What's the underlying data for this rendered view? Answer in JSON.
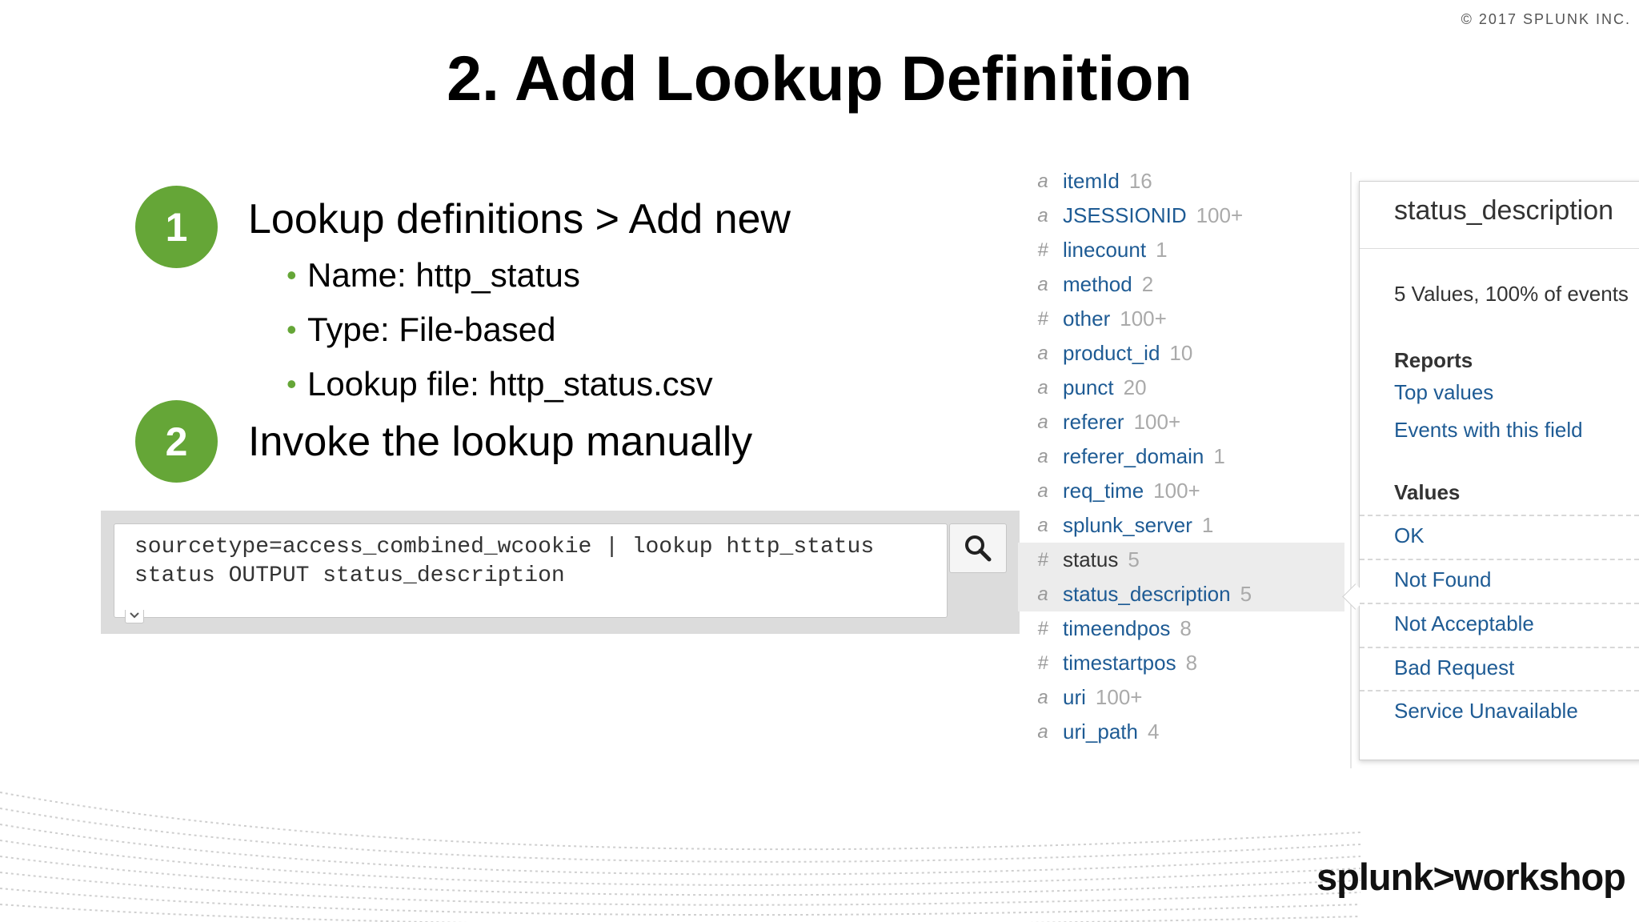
{
  "copyright": "© 2017 SPLUNK INC.",
  "slide_title": "2. Add Lookup Definition",
  "steps": [
    {
      "number": "1",
      "heading": "Lookup definitions > Add new",
      "bullets": [
        "Name: http_status",
        "Type: File-based",
        "Lookup file: http_status.csv"
      ]
    },
    {
      "number": "2",
      "heading": "Invoke the lookup manually"
    }
  ],
  "search": {
    "query_line1": "sourcetype=access_combined_wcookie | lookup http_status",
    "query_line2": "status OUTPUT status_description",
    "button_icon": "search-icon"
  },
  "fields": [
    {
      "type": "a",
      "name": "itemId",
      "count": "16"
    },
    {
      "type": "a",
      "name": "JSESSIONID",
      "count": "100+"
    },
    {
      "type": "#",
      "name": "linecount",
      "count": "1"
    },
    {
      "type": "a",
      "name": "method",
      "count": "2"
    },
    {
      "type": "#",
      "name": "other",
      "count": "100+"
    },
    {
      "type": "a",
      "name": "product_id",
      "count": "10"
    },
    {
      "type": "a",
      "name": "punct",
      "count": "20"
    },
    {
      "type": "a",
      "name": "referer",
      "count": "100+"
    },
    {
      "type": "a",
      "name": "referer_domain",
      "count": "1"
    },
    {
      "type": "a",
      "name": "req_time",
      "count": "100+"
    },
    {
      "type": "a",
      "name": "splunk_server",
      "count": "1"
    },
    {
      "type": "#",
      "name": "status",
      "count": "5"
    },
    {
      "type": "a",
      "name": "status_description",
      "count": "5"
    },
    {
      "type": "#",
      "name": "timeendpos",
      "count": "8"
    },
    {
      "type": "#",
      "name": "timestartpos",
      "count": "8"
    },
    {
      "type": "a",
      "name": "uri",
      "count": "100+"
    },
    {
      "type": "a",
      "name": "uri_path",
      "count": "4"
    }
  ],
  "popup": {
    "title": "status_description",
    "summary": "5 Values, 100% of events",
    "reports_heading": "Reports",
    "report_links": [
      "Top values",
      "Events with this field"
    ],
    "values_heading": "Values",
    "values": [
      "OK",
      "Not Found",
      "Not Acceptable",
      "Bad Request",
      "Service Unavailable"
    ]
  },
  "logo": {
    "brand": "splunk",
    "separator": ">",
    "product": "workshop"
  },
  "colors": {
    "step_green": "#65a637",
    "link_blue": "#1e5b94",
    "band_gray": "#dcdcdc"
  }
}
